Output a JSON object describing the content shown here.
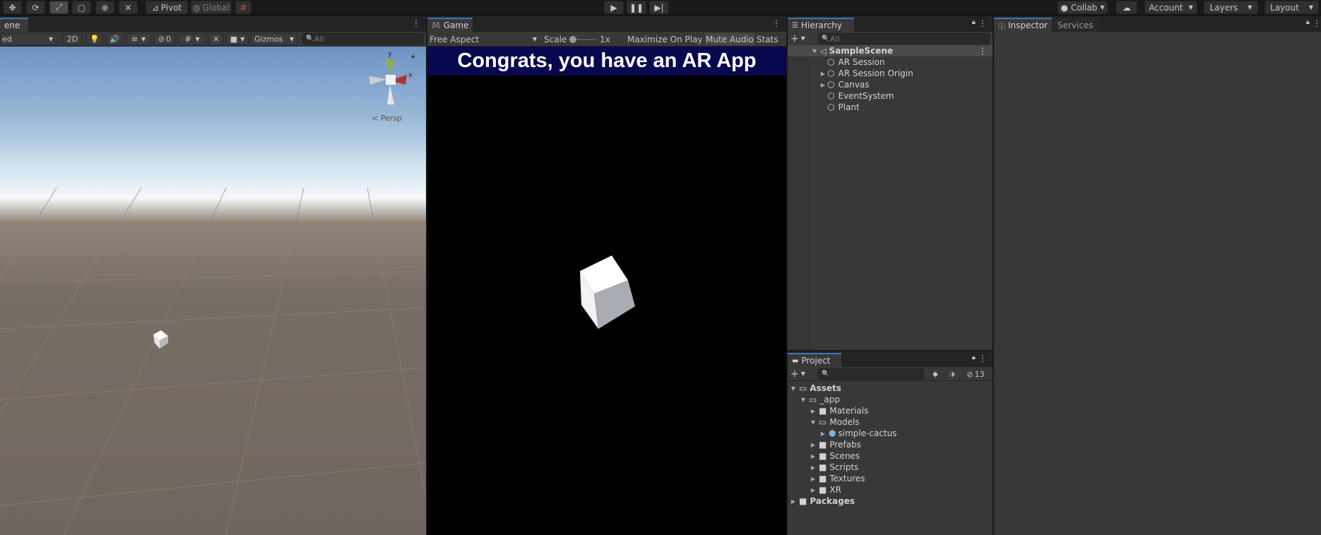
{
  "toolbar": {
    "pivot_label": "Pivot",
    "global_label": "Global",
    "collab_label": "Collab",
    "account_label": "Account",
    "layers_label": "Layers",
    "layout_label": "Layout"
  },
  "scene": {
    "tab_label": "ene",
    "shading_mode": "ed",
    "mode_2d_label": "2D",
    "hidden_count": "0",
    "gizmos_label": "Gizmos",
    "search_placeholder": "All",
    "persp_label": "< Persp",
    "gizmo_axes": {
      "y": "y",
      "x": "x"
    }
  },
  "game": {
    "tab_label": "Game",
    "aspect_label": "Free Aspect",
    "scale_label": "Scale",
    "scale_value": "1x",
    "maximize_label": "Maximize On Play",
    "mute_label": "Mute Audio",
    "stats_label": "Stats",
    "banner_text": "Congrats, you have an AR App"
  },
  "hierarchy": {
    "tab_label": "Hierarchy",
    "search_placeholder": "All",
    "scene_name": "SampleScene",
    "items": [
      {
        "label": "AR Session",
        "expandable": false
      },
      {
        "label": "AR Session Origin",
        "expandable": true
      },
      {
        "label": "Canvas",
        "expandable": true
      },
      {
        "label": "EventSystem",
        "expandable": false
      },
      {
        "label": "Plant",
        "expandable": false
      }
    ]
  },
  "project": {
    "tab_label": "Project",
    "hidden_count": "13",
    "tree": [
      {
        "label": "Assets",
        "level": 0,
        "arrow": "down",
        "bold": true,
        "icon": "folder-open-icon"
      },
      {
        "label": "_app",
        "level": 1,
        "arrow": "down",
        "bold": false,
        "icon": "folder-open-icon"
      },
      {
        "label": "Materials",
        "level": 2,
        "arrow": "right",
        "bold": false,
        "icon": "folder-icon"
      },
      {
        "label": "Models",
        "level": 2,
        "arrow": "down",
        "bold": false,
        "icon": "folder-open-icon"
      },
      {
        "label": "simple-cactus",
        "level": 3,
        "arrow": "right",
        "bold": false,
        "icon": "model-icon"
      },
      {
        "label": "Prefabs",
        "level": 2,
        "arrow": "right",
        "bold": false,
        "icon": "folder-icon"
      },
      {
        "label": "Scenes",
        "level": 2,
        "arrow": "right",
        "bold": false,
        "icon": "folder-icon"
      },
      {
        "label": "Scripts",
        "level": 2,
        "arrow": "right",
        "bold": false,
        "icon": "folder-icon"
      },
      {
        "label": "Textures",
        "level": 2,
        "arrow": "right",
        "bold": false,
        "icon": "folder-icon"
      },
      {
        "label": "XR",
        "level": 2,
        "arrow": "right",
        "bold": false,
        "icon": "folder-icon"
      },
      {
        "label": "Packages",
        "level": 0,
        "arrow": "right",
        "bold": true,
        "icon": "folder-icon"
      }
    ]
  },
  "inspector": {
    "tab_label": "Inspector",
    "services_label": "Services"
  },
  "colors": {
    "accent": "#3a79bb",
    "banner_bg": "#08084e",
    "panel_bg": "#383838"
  }
}
